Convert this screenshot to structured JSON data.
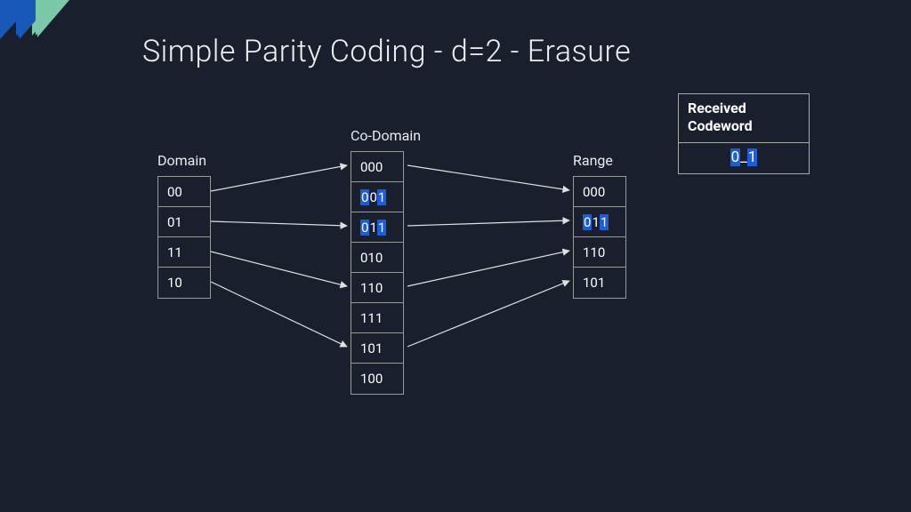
{
  "title": "Simple Parity Coding - d=2 - Erasure",
  "labels": {
    "domain": "Domain",
    "codomain": "Co-Domain",
    "range": "Range"
  },
  "domain": [
    "00",
    "01",
    "11",
    "10"
  ],
  "codomain": [
    {
      "text": "000",
      "hl": null
    },
    {
      "text": "001",
      "hl": [
        0,
        2
      ]
    },
    {
      "text": "011",
      "hl": [
        0,
        2
      ]
    },
    {
      "text": "010",
      "hl": null
    },
    {
      "text": "110",
      "hl": null
    },
    {
      "text": "111",
      "hl": null
    },
    {
      "text": "101",
      "hl": null
    },
    {
      "text": "100",
      "hl": null
    }
  ],
  "range": [
    {
      "text": "000",
      "hl": null
    },
    {
      "text": "011",
      "hl": [
        0,
        2
      ]
    },
    {
      "text": "110",
      "hl": null
    },
    {
      "text": "101",
      "hl": null
    }
  ],
  "received": {
    "header": "Received Codeword",
    "chars": [
      {
        "t": "0",
        "hl": true
      },
      {
        "t": "_",
        "hl": false
      },
      {
        "t": "1",
        "hl": true
      }
    ]
  },
  "colors": {
    "bg": "#1a1f2e",
    "blue": "#1858b8",
    "teal": "#7bc9a8",
    "highlight": "#1e5dd9",
    "arrow": "#e0e0e0"
  }
}
